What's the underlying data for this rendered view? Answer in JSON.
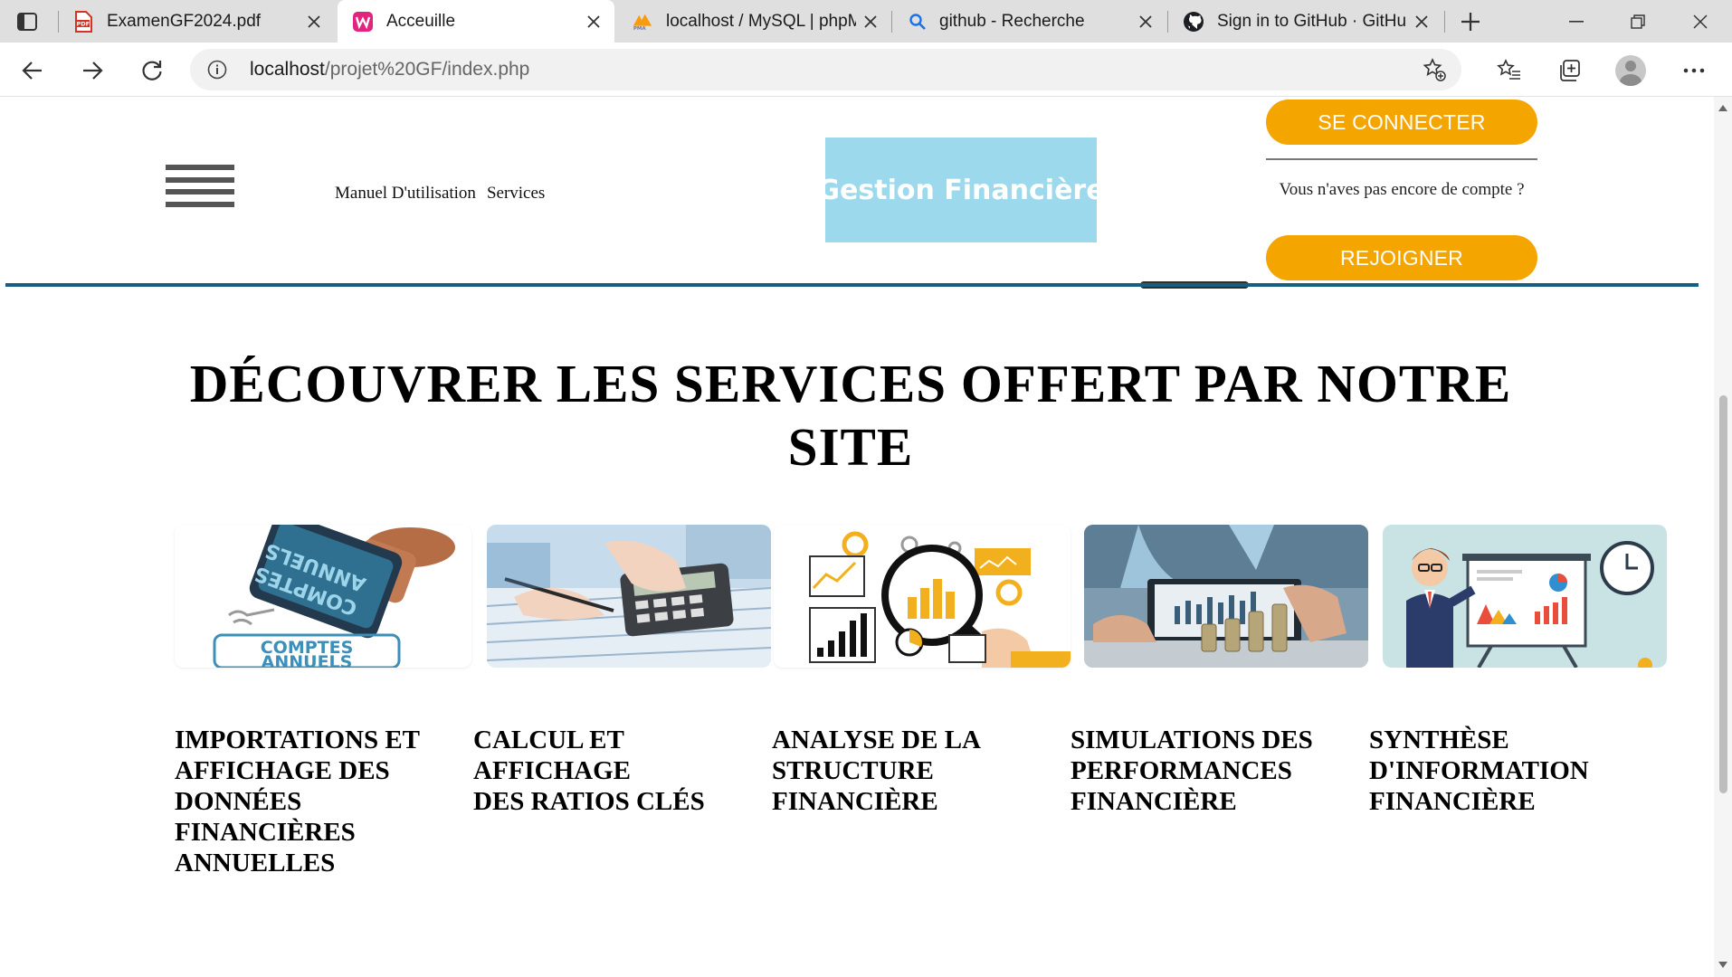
{
  "browser": {
    "tabs": [
      {
        "title": "ExamenGF2024.pdf",
        "favicon": "pdf-icon"
      },
      {
        "title": "Acceuille",
        "favicon": "wamp-icon",
        "active": true
      },
      {
        "title": "localhost / MySQL | phpM",
        "favicon": "phpmyadmin-icon"
      },
      {
        "title": "github - Recherche",
        "favicon": "search-icon"
      },
      {
        "title": "Sign in to GitHub · GitHub",
        "favicon": "github-icon"
      }
    ],
    "url_host": "localhost",
    "url_path": "/projet%20GF/index.php"
  },
  "header": {
    "nav_links": [
      "Manuel D'utilisation",
      "Services"
    ],
    "logo_text": "Gestion Financière",
    "login_label": "SE CONNECTER",
    "no_account_text": "Vous n'aves pas encore de compte ?",
    "join_label": "REJOIGNER"
  },
  "section": {
    "title_line1": "DÉCOUVRER LES SERVICES OFFERT PAR NOTRE",
    "title_line2": "SITE"
  },
  "services": [
    {
      "image": "comptes-annuels-stamp",
      "stamp_line1": "COMPTES",
      "stamp_line2": "ANNUELS",
      "title_lines": [
        "IMPORTATIONS ET",
        "AFFICHAGE DES",
        "DONNÉES",
        "FINANCIÈRES",
        "ANNUELLES"
      ]
    },
    {
      "image": "calculator-hands",
      "title_lines": [
        "CALCUL ET",
        "AFFICHAGE",
        "DES RATIOS CLÉS"
      ]
    },
    {
      "image": "magnifier-charts",
      "title_lines": [
        "ANALYSE DE LA",
        "STRUCTURE",
        "FINANCIÈRE"
      ]
    },
    {
      "image": "laptop-coins",
      "title_lines": [
        "SIMULATIONS DES",
        "PERFORMANCES",
        "FINANCIÈRE"
      ]
    },
    {
      "image": "presenter-board",
      "title_lines": [
        "SYNTHÈSE",
        "D'INFORMATION",
        "FINANCIÈRE"
      ]
    }
  ],
  "colors": {
    "accent_orange": "#f5a500",
    "header_line": "#15607e",
    "logo_bg": "#9dd9ec"
  }
}
